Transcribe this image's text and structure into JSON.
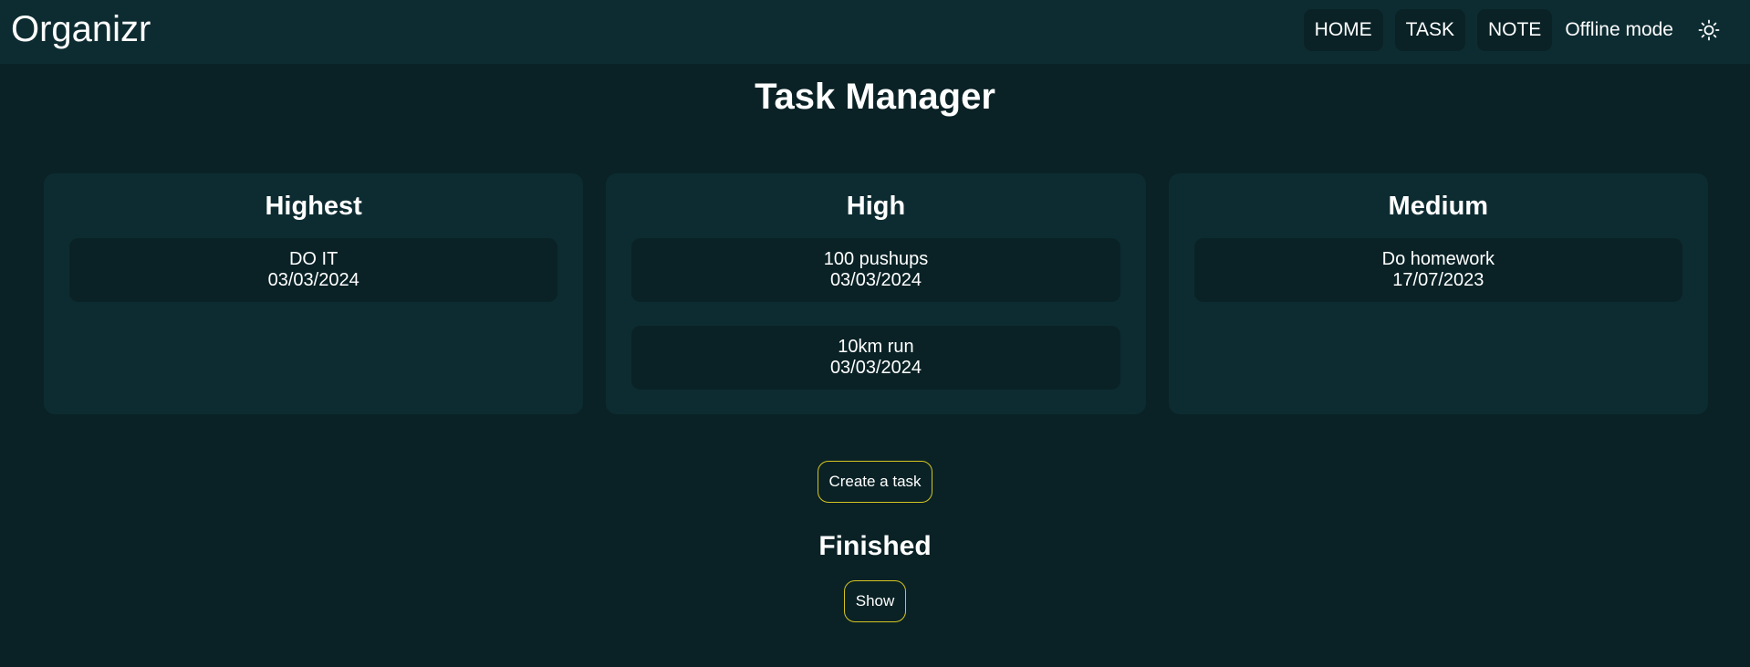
{
  "header": {
    "brand": "Organizr",
    "nav": [
      {
        "label": "HOME"
      },
      {
        "label": "TASK"
      },
      {
        "label": "NOTE"
      }
    ],
    "status": "Offline mode",
    "theme_icon": "sun-icon"
  },
  "main": {
    "title": "Task Manager",
    "columns": [
      {
        "title": "Highest",
        "tasks": [
          {
            "name": "DO IT",
            "date": "03/03/2024"
          }
        ]
      },
      {
        "title": "High",
        "tasks": [
          {
            "name": "100 pushups",
            "date": "03/03/2024"
          },
          {
            "name": "10km run",
            "date": "03/03/2024"
          }
        ]
      },
      {
        "title": "Medium",
        "tasks": [
          {
            "name": "Do homework",
            "date": "17/07/2023"
          }
        ]
      }
    ],
    "create_label": "Create a task",
    "finished_title": "Finished",
    "show_label": "Show"
  },
  "colors": {
    "background": "#0a2226",
    "panel": "#0d2c31",
    "accent_border": "#d4c420",
    "text": "#ffffff"
  }
}
